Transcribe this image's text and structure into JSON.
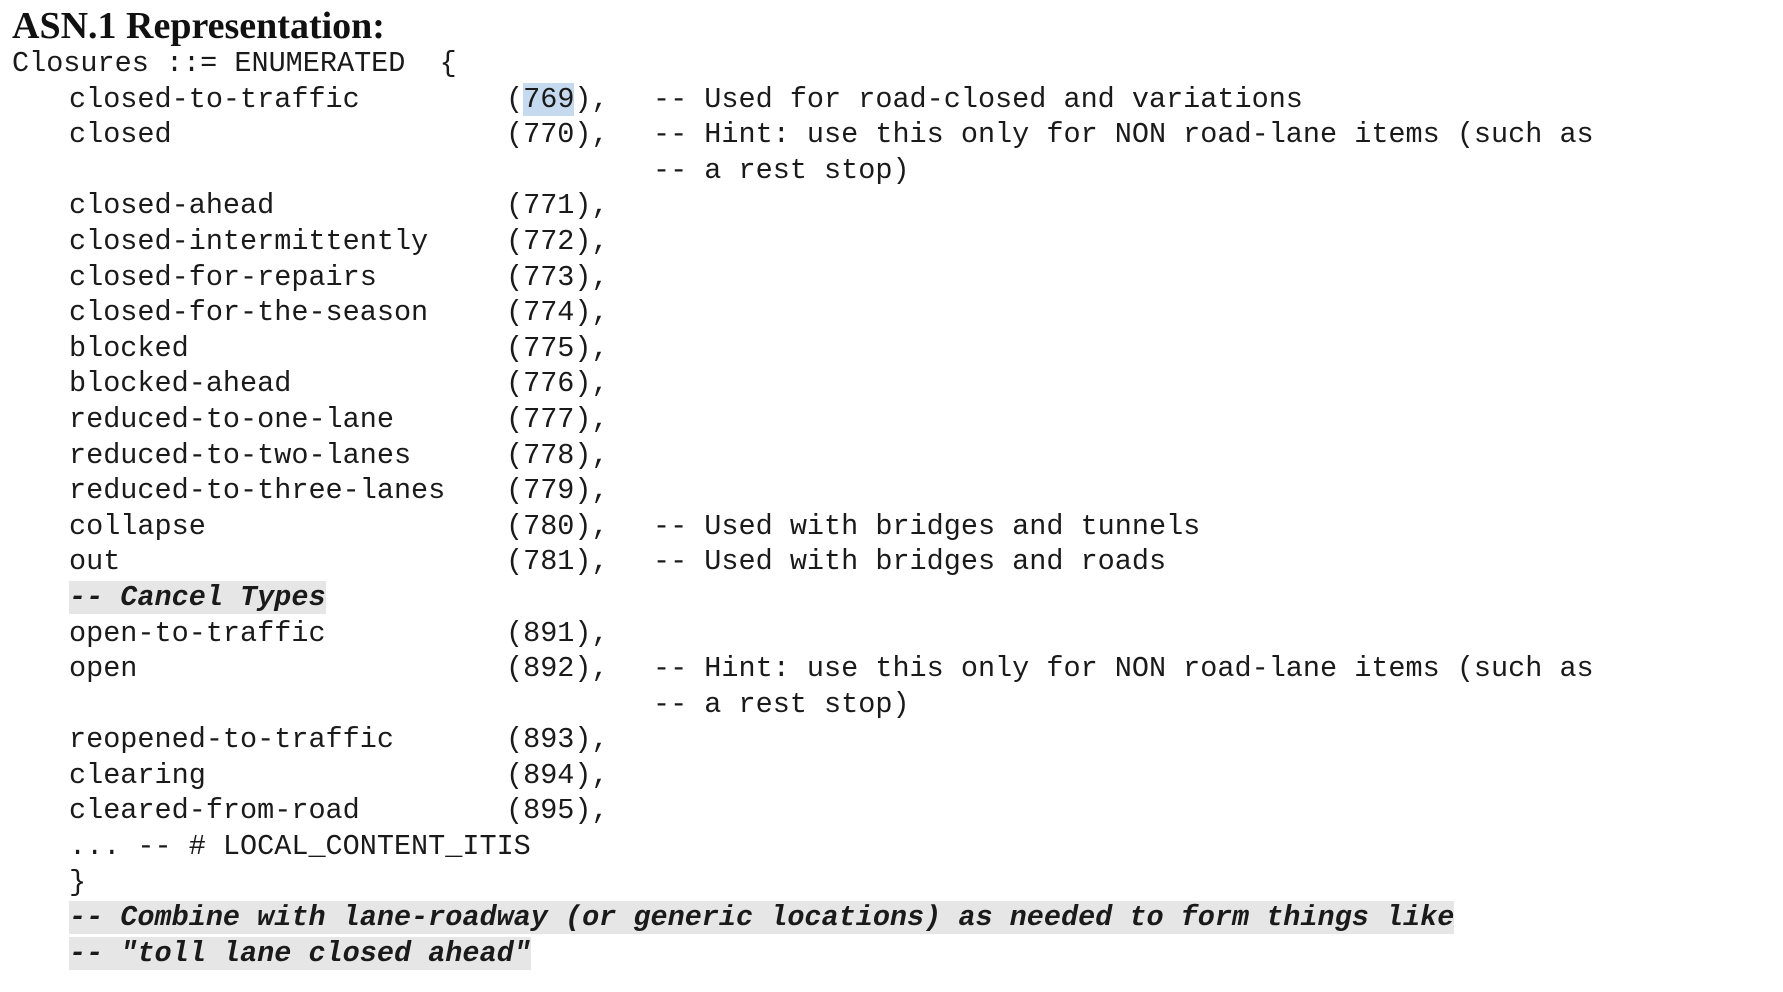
{
  "heading": "ASN.1 Representation:",
  "declaration": {
    "type_name": "Closures",
    "assign": "::=",
    "keyword": "ENUMERATED",
    "open_brace": "{"
  },
  "items": [
    {
      "name": "closed-to-traffic",
      "code_open": "(",
      "code_value": "769",
      "code_close": "),",
      "comment": "-- Used for road-closed and variations",
      "value_selected": true
    },
    {
      "name": "closed",
      "code": "(770),",
      "comment": "-- Hint: use this only for NON road-lane items (such as",
      "comment_cont": "-- a rest stop)"
    },
    {
      "name": "closed-ahead",
      "code": "(771),"
    },
    {
      "name": "closed-intermittently",
      "code": "(772),"
    },
    {
      "name": "closed-for-repairs",
      "code": "(773),"
    },
    {
      "name": "closed-for-the-season",
      "code": "(774),"
    },
    {
      "name": "blocked",
      "code": "(775),"
    },
    {
      "name": "blocked-ahead",
      "code": "(776),"
    },
    {
      "name": "reduced-to-one-lane",
      "code": "(777),"
    },
    {
      "name": "reduced-to-two-lanes",
      "code": "(778),"
    },
    {
      "name": "reduced-to-three-lanes",
      "code": "(779),"
    },
    {
      "name": "collapse",
      "code": "(780),",
      "comment": "-- Used with bridges and tunnels"
    },
    {
      "name": "out",
      "code": "(781),",
      "comment": "-- Used with bridges and roads"
    }
  ],
  "cancel_comment": "-- Cancel Types",
  "cancel_items": [
    {
      "name": "open-to-traffic",
      "code": "(891),"
    },
    {
      "name": "open",
      "code": "(892),",
      "comment": "-- Hint: use this only for NON road-lane items (such as",
      "comment_cont": "-- a rest stop)"
    },
    {
      "name": "reopened-to-traffic",
      "code": "(893),"
    },
    {
      "name": "clearing",
      "code": "(894),"
    },
    {
      "name": "cleared-from-road",
      "code": "(895),"
    }
  ],
  "extension_line": "... -- # LOCAL_CONTENT_ITIS",
  "close_brace": "}",
  "footer_comments": [
    "-- Combine with lane-roadway (or generic locations) as needed to form things like",
    "-- \"toll lane closed ahead\""
  ],
  "colors": {
    "selection_highlight": "#c5d9ef",
    "comment_shading": "#e6e6e6",
    "text": "#1a1a1a"
  }
}
